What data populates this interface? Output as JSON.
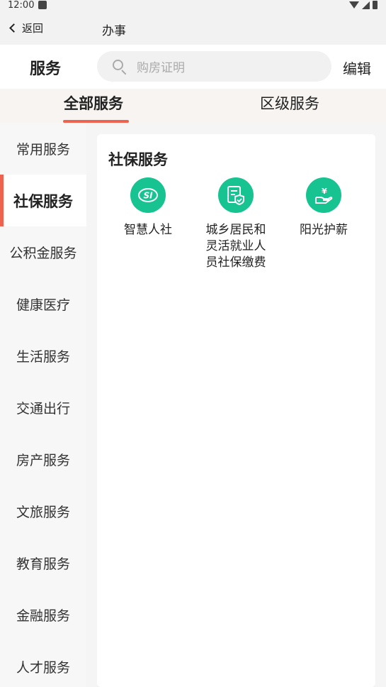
{
  "status_bar": {
    "time": "12:00"
  },
  "nav": {
    "back_label": "返回",
    "title": "办事"
  },
  "search": {
    "label": "服务",
    "placeholder": "购房证明",
    "edit_label": "编辑"
  },
  "tabs": [
    {
      "label": "全部服务",
      "active": true
    },
    {
      "label": "区级服务",
      "active": false
    }
  ],
  "sidebar": {
    "items": [
      {
        "label": "常用服务"
      },
      {
        "label": "社保服务",
        "active": true
      },
      {
        "label": "公积金服务"
      },
      {
        "label": "健康医疗"
      },
      {
        "label": "生活服务"
      },
      {
        "label": "交通出行"
      },
      {
        "label": "房产服务"
      },
      {
        "label": "文旅服务"
      },
      {
        "label": "教育服务"
      },
      {
        "label": "金融服务"
      },
      {
        "label": "人才服务"
      }
    ]
  },
  "section": {
    "title": "社保服务",
    "services": [
      {
        "label": "智慧人社",
        "icon": "si-logo-icon",
        "icon_text": "SI"
      },
      {
        "label": "城乡居民和灵活就业人员社保缴费",
        "icon": "document-shield-icon"
      },
      {
        "label": "阳光护薪",
        "icon": "yuan-hand-icon",
        "icon_text": "¥"
      }
    ]
  },
  "colors": {
    "accent": "#ee6350",
    "icon_green": "#17c491"
  }
}
